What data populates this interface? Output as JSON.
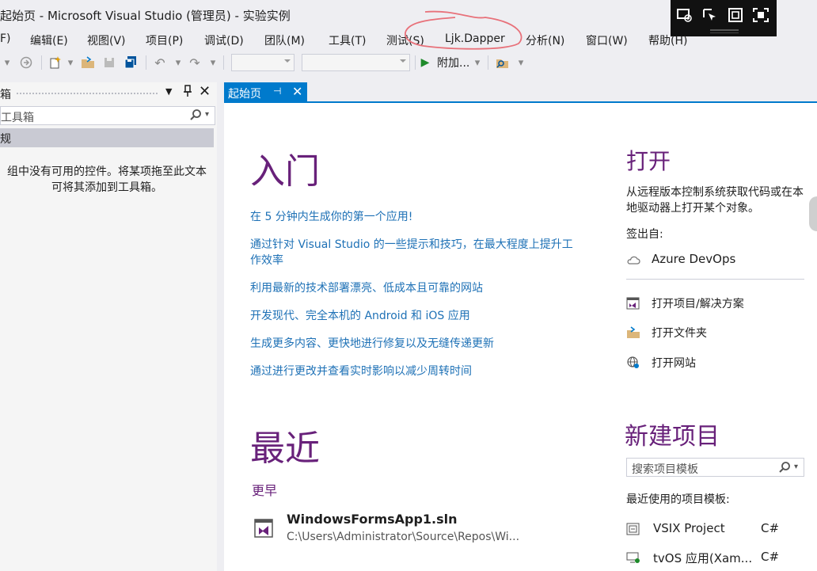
{
  "window": {
    "title": "起始页 - Microsoft Visual Studio (管理员) - 实验实例"
  },
  "menu": [
    "F)",
    "编辑(E)",
    "视图(V)",
    "项目(P)",
    "调试(D)",
    "团队(M)",
    "工具(T)",
    "测试(S)",
    "Ljk.Dapper",
    "分析(N)",
    "窗口(W)",
    "帮助(H)"
  ],
  "toolbar": {
    "attach_label": "附加..."
  },
  "toolbox": {
    "title": "箱",
    "search_placeholder": "工具箱",
    "group_label": "规",
    "empty_message": "组中没有可用的控件。将某项拖至此文本\n可将其添加到工具箱。"
  },
  "tab": {
    "label": "起始页"
  },
  "start": {
    "getting_started": {
      "heading": "入门",
      "links": [
        "在 5 分钟内生成你的第一个应用!",
        "通过针对 Visual Studio 的一些提示和技巧，在最大程度上提升工作效率",
        "利用最新的技术部署漂亮、低成本且可靠的网站",
        "开发现代、完全本机的 Android 和 iOS 应用",
        "生成更多内容、更快地进行修复以及无缝传递更新",
        "通过进行更改并查看实时影响以减少周转时间"
      ]
    },
    "recent": {
      "heading": "最近",
      "group": "更早",
      "items": [
        {
          "name": "WindowsFormsApp1.sln",
          "path": "C:\\Users\\Administrator\\Source\\Repos\\Wi..."
        }
      ]
    },
    "open": {
      "heading": "打开",
      "description": "从远程版本控制系统获取代码或在本地驱动器上打开某个对象。",
      "checkout_label": "签出自:",
      "azure": "Azure DevOps",
      "open_project": "打开项目/解决方案",
      "open_folder": "打开文件夹",
      "open_website": "打开网站"
    },
    "new_project": {
      "heading": "新建项目",
      "search_placeholder": "搜索项目模板",
      "recent_label": "最近使用的项目模板:",
      "templates": [
        {
          "name": "VSIX Project",
          "lang": "C#"
        },
        {
          "name": "tvOS 应用(Xam...",
          "lang": "C#"
        }
      ]
    }
  },
  "colors": {
    "accent": "#007acc",
    "heading": "#68217a",
    "link": "#1e71b6",
    "annotation": "#e8717a"
  }
}
